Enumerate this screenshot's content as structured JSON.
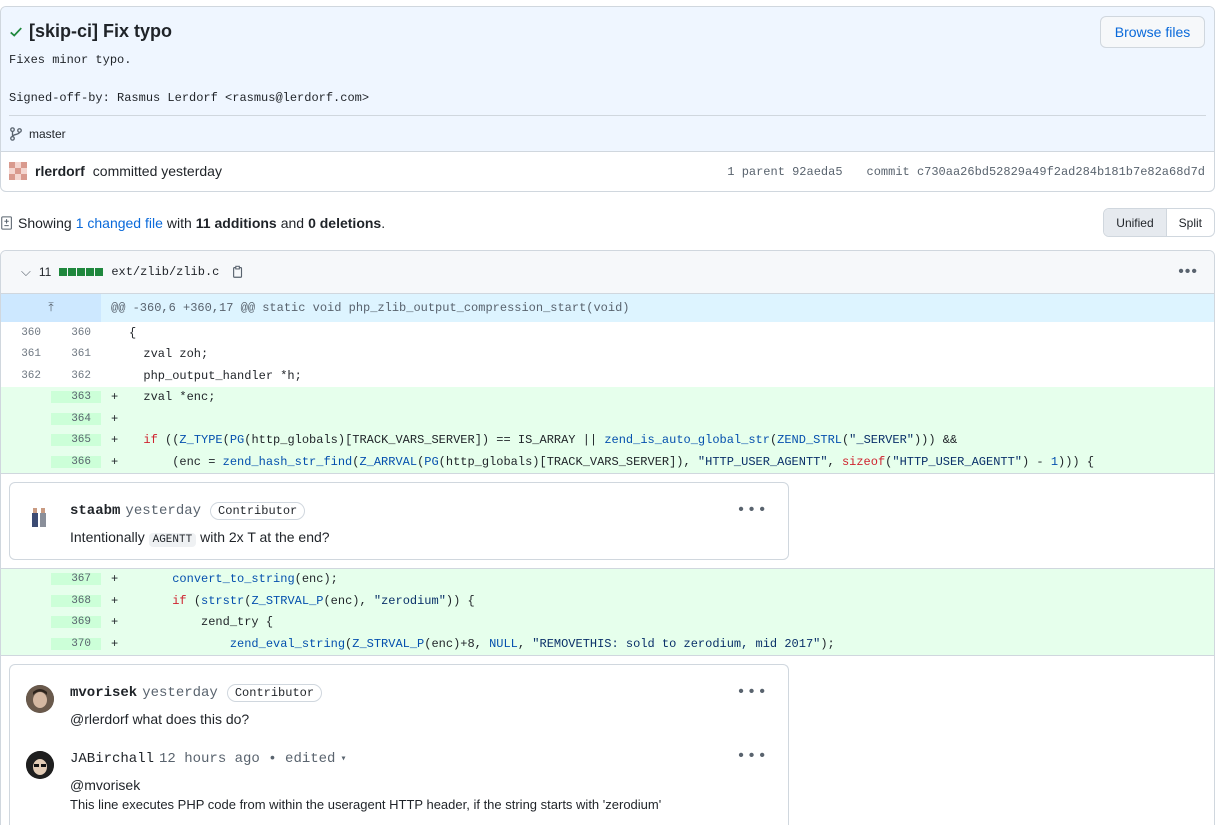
{
  "commit": {
    "title": "[skip-ci] Fix typo",
    "description": "Fixes minor typo.\n\nSigned-off-by: Rasmus Lerdorf <rasmus@lerdorf.com>",
    "browse_label": "Browse files",
    "branch": "master",
    "author": "rlerdorf",
    "committed_text": "committed yesterday",
    "parent_label": "1 parent",
    "parent_sha": "92aeda5",
    "commit_label": "commit",
    "commit_sha": "c730aa26bd52829a49f2ad284b181b7e82a68d7d"
  },
  "summary": {
    "showing": "Showing",
    "changed": "1 changed file",
    "with": "with",
    "additions": "11 additions",
    "and": "and",
    "deletions": "0 deletions",
    "period": ".",
    "unified": "Unified",
    "split": "Split"
  },
  "file": {
    "count": "11",
    "path": "ext/zlib/zlib.c",
    "hunk": "@@ -360,6 +360,17 @@ static void php_zlib_output_compression_start(void)"
  },
  "comments": {
    "first": {
      "author": "staabm",
      "time": "yesterday",
      "badge": "Contributor",
      "body_pre": "Intentionally",
      "body_code": "AGENTT",
      "body_post": "with 2x T at the end?"
    },
    "second": {
      "author": "mvorisek",
      "time": "yesterday",
      "badge": "Contributor",
      "body": "@rlerdorf what does this do?"
    },
    "third": {
      "author": "JABirchall",
      "time": "12 hours ago • edited",
      "body_mention": "@mvorisek",
      "body": "This line executes PHP code from within the useragent HTTP header, if the string starts with 'zerodium'"
    }
  },
  "colors": {
    "accent": "#0969da",
    "add_bg": "#e6ffec",
    "add_num_bg": "#ccffd8",
    "success": "#1f883d"
  }
}
